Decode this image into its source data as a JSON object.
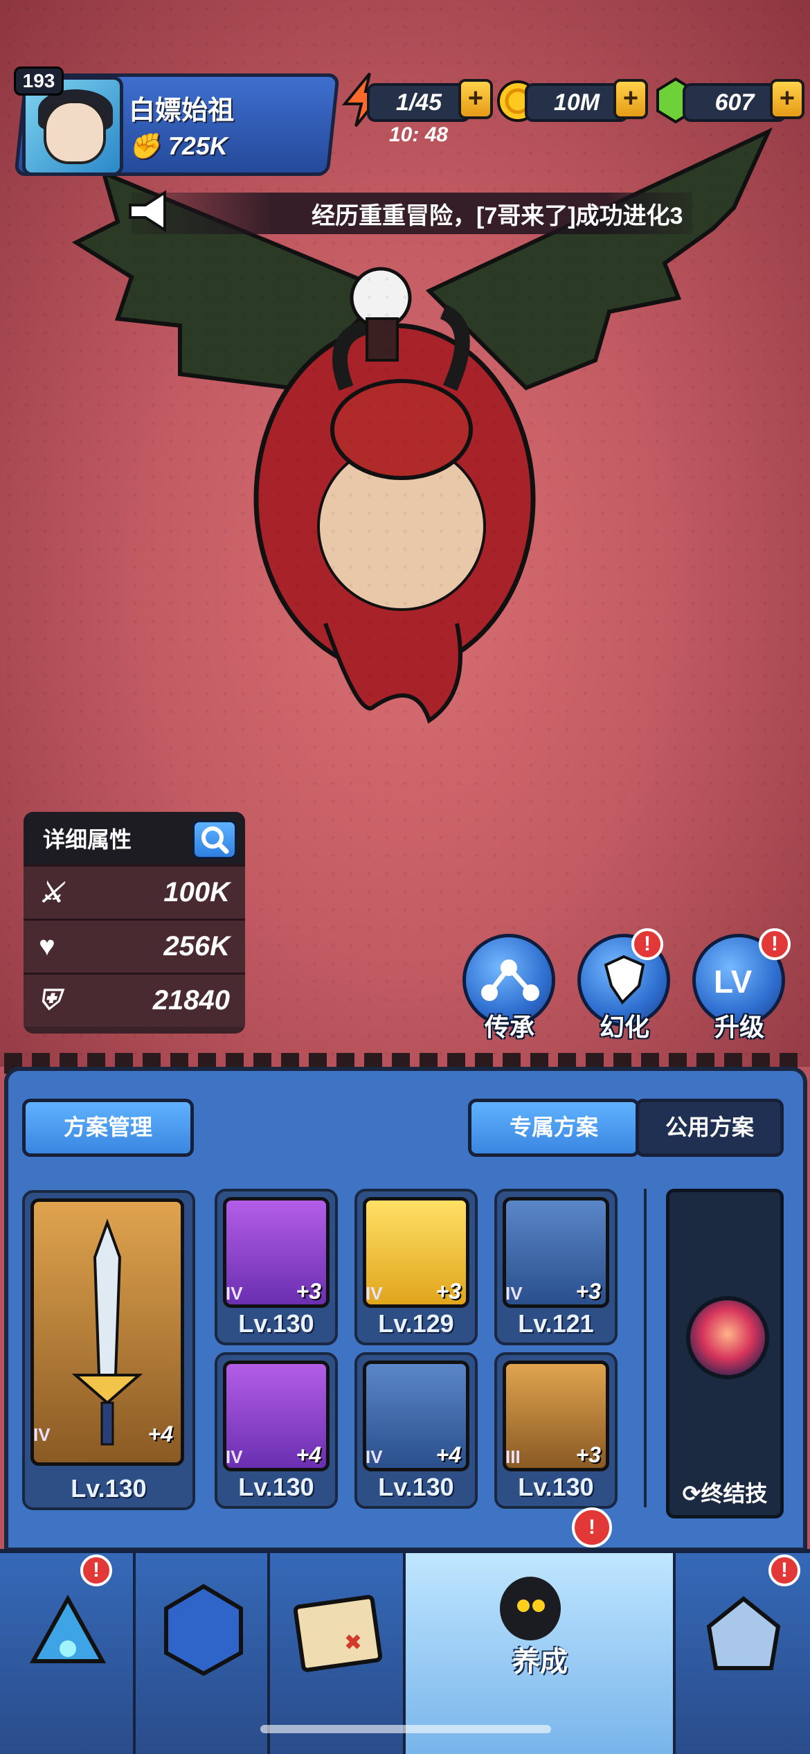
{
  "player": {
    "level": "193",
    "name": "白嫖始祖",
    "power": "725K"
  },
  "resources": {
    "energy": "1/45",
    "energy_timer": "10: 48",
    "coins": "10M",
    "gems": "607"
  },
  "ticker": {
    "text": "经历重重冒险，[7哥来了]成功进化3"
  },
  "stats": {
    "title": "详细属性",
    "attack": "100K",
    "hp": "256K",
    "defense": "21840"
  },
  "actions": [
    {
      "label": "传承",
      "alert": false
    },
    {
      "label": "幻化",
      "alert": true
    },
    {
      "label": "升级",
      "alert": true
    }
  ],
  "panel": {
    "manage_label": "方案管理",
    "tabs": [
      {
        "label": "专属方案",
        "active": true
      },
      {
        "label": "公用方案",
        "active": false
      }
    ],
    "weapon": {
      "tier": "IV",
      "plus": "+4",
      "level": "Lv.130"
    },
    "equipment": [
      {
        "name": "helmet",
        "tier": "IV",
        "plus": "+3",
        "level": "Lv.130",
        "rarity": "purple"
      },
      {
        "name": "armor",
        "tier": "IV",
        "plus": "+3",
        "level": "Lv.129",
        "rarity": "gold"
      },
      {
        "name": "pants",
        "tier": "IV",
        "plus": "+3",
        "level": "Lv.121",
        "rarity": "blue"
      },
      {
        "name": "gauntlet",
        "tier": "IV",
        "plus": "+4",
        "level": "Lv.130",
        "rarity": "purple"
      },
      {
        "name": "boots",
        "tier": "IV",
        "plus": "+4",
        "level": "Lv.130",
        "rarity": "blue"
      },
      {
        "name": "necklace",
        "tier": "III",
        "plus": "+3",
        "level": "Lv.130",
        "rarity": "bronze"
      }
    ],
    "ultimate_label": "终结技"
  },
  "nav": {
    "active_label": "养成"
  },
  "icons": {
    "energy": "lightning-icon",
    "coin": "coin-icon",
    "gem": "gem-icon",
    "announce": "megaphone-icon"
  }
}
